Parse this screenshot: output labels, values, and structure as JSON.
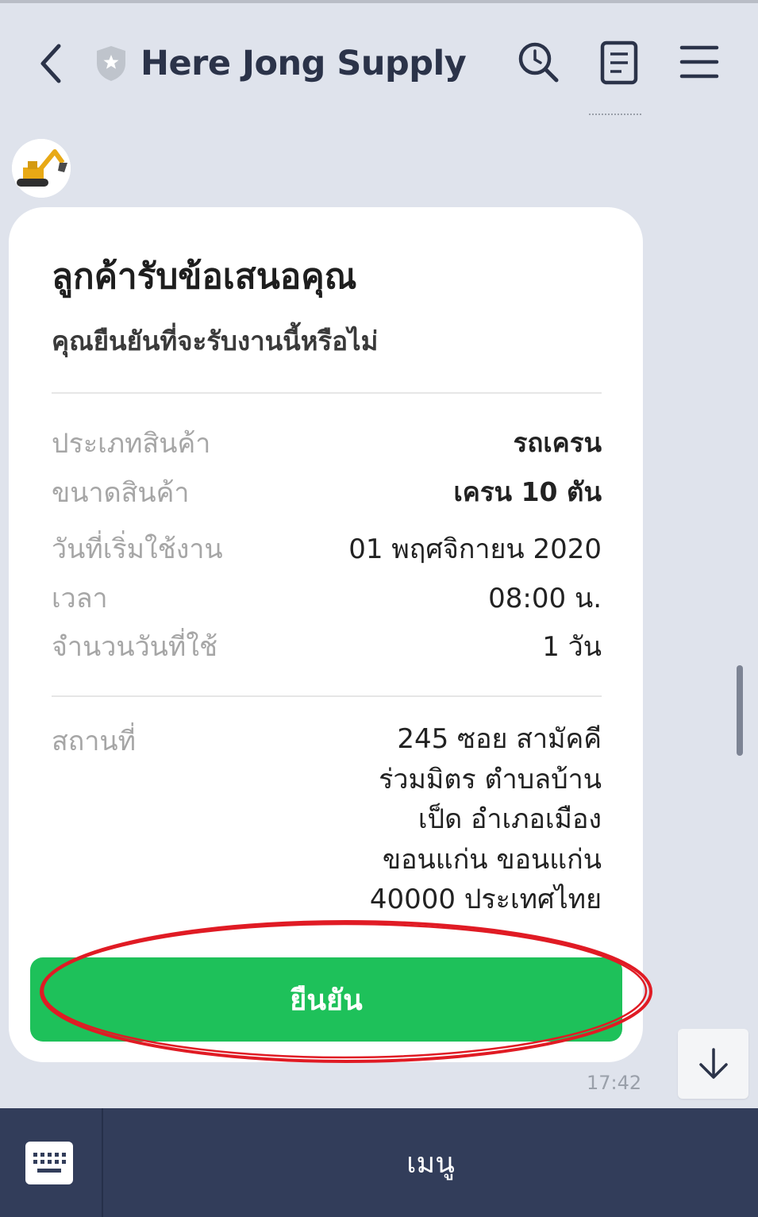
{
  "header": {
    "title": "Here Jong Supply"
  },
  "card": {
    "title": "ลูกค้ารับข้อเสนอคุณ",
    "subtitle": "คุณยืนยันที่จะรับงานนี้หรือไม่",
    "rows": [
      {
        "label": "ประเภทสินค้า",
        "value": "รถเครน"
      },
      {
        "label": "ขนาดสินค้า",
        "value": "เครน 10 ตัน"
      },
      {
        "label": "วันที่เริ่มใช้งาน",
        "value": "01 พฤศจิกายน 2020"
      },
      {
        "label": "เวลา",
        "value": "08:00 น."
      },
      {
        "label": "จำนวนวันที่ใช้",
        "value": "1 วัน"
      }
    ],
    "location": {
      "label": "สถานที่",
      "lines": [
        "245 ซอย สามัคคี",
        "ร่วมมิตร ตำบลบ้าน",
        "เป็ด อำเภอเมือง",
        "ขอนแก่น ขอนแก่น",
        "40000 ประเทศไทย"
      ]
    },
    "confirm_label": "ยืนยัน"
  },
  "message_time": "17:42",
  "bottom_bar": {
    "menu_label": "เมนู"
  },
  "colors": {
    "background": "#dfe3ec",
    "title_text": "#2b3349",
    "confirm_green": "#1ec15a",
    "annotation_red": "#e01b24",
    "bottom_bar": "#323d5a"
  },
  "icons": [
    "back-icon",
    "shield-icon",
    "search-icon",
    "notes-icon",
    "menu-icon",
    "arrow-down-icon",
    "keyboard-icon"
  ]
}
